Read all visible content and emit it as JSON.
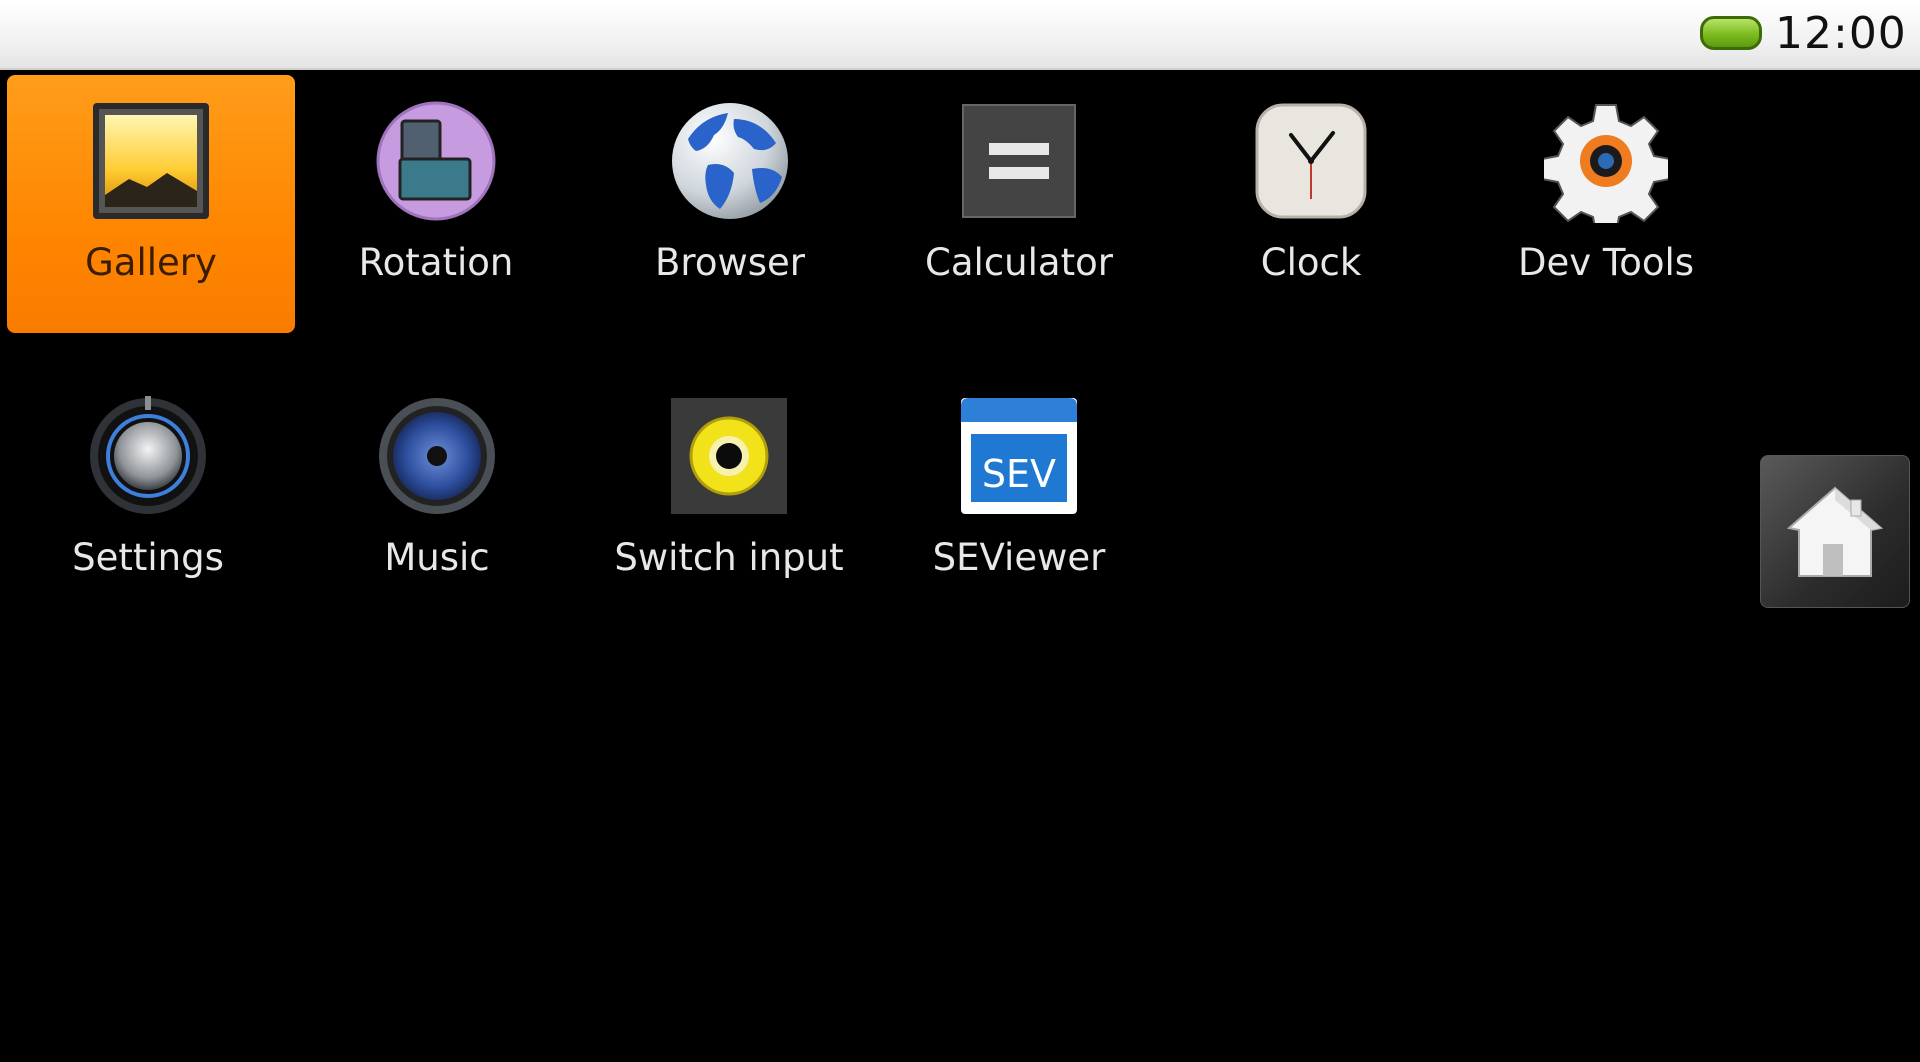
{
  "status_bar": {
    "time": "12:00",
    "battery_icon": "battery-icon",
    "battery_color": "#7dbb1e"
  },
  "apps": [
    {
      "label": "Gallery",
      "icon": "gallery-icon",
      "selected": true
    },
    {
      "label": "Rotation",
      "icon": "rotation-icon"
    },
    {
      "label": "Browser",
      "icon": "globe-icon"
    },
    {
      "label": "Calculator",
      "icon": "calculator-icon"
    },
    {
      "label": "Clock",
      "icon": "clock-icon"
    },
    {
      "label": "Dev Tools",
      "icon": "gear-icon"
    },
    {
      "label": "Settings",
      "icon": "settings-knob-icon"
    },
    {
      "label": "Music",
      "icon": "speaker-icon"
    },
    {
      "label": "Switch input",
      "icon": "rca-jack-icon"
    },
    {
      "label": "SEViewer",
      "icon": "seviewer-icon",
      "icon_text": "SEV"
    }
  ],
  "home_button": {
    "icon": "home-icon"
  },
  "colors": {
    "selection": "#ff8600",
    "background": "#000000",
    "label": "#e8e8e8"
  }
}
